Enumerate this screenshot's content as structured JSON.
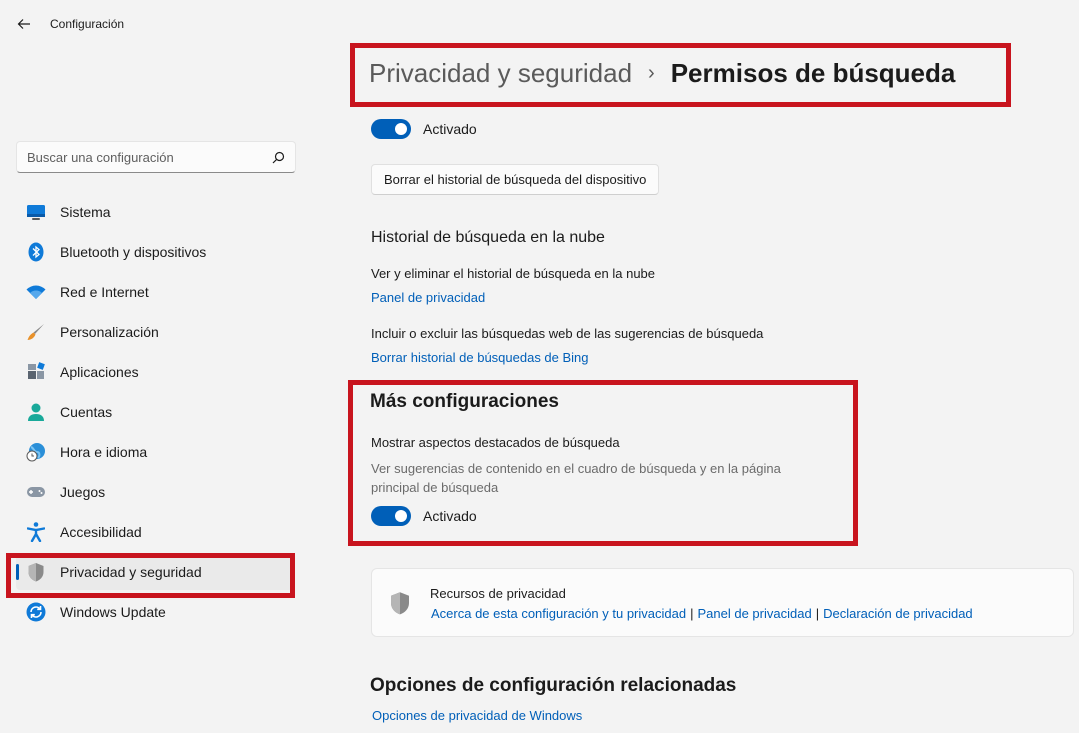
{
  "window": {
    "title": "Configuración"
  },
  "search": {
    "placeholder": "Buscar una configuración"
  },
  "sidebar": {
    "items": [
      {
        "label": "Sistema",
        "icon": "monitor-icon"
      },
      {
        "label": "Bluetooth y dispositivos",
        "icon": "bluetooth-icon"
      },
      {
        "label": "Red e Internet",
        "icon": "wifi-icon"
      },
      {
        "label": "Personalización",
        "icon": "paintbrush-icon"
      },
      {
        "label": "Aplicaciones",
        "icon": "apps-icon"
      },
      {
        "label": "Cuentas",
        "icon": "person-icon"
      },
      {
        "label": "Hora e idioma",
        "icon": "globe-clock-icon"
      },
      {
        "label": "Juegos",
        "icon": "gamepad-icon"
      },
      {
        "label": "Accesibilidad",
        "icon": "accessibility-icon"
      },
      {
        "label": "Privacidad y seguridad",
        "icon": "shield-icon",
        "active": true
      },
      {
        "label": "Windows Update",
        "icon": "update-icon"
      }
    ]
  },
  "header": {
    "parent": "Privacidad y seguridad",
    "separator": "›",
    "current": "Permisos de búsqueda"
  },
  "main": {
    "toggle_top": {
      "label": "Activado",
      "on": true
    },
    "clear_device_history_button": "Borrar el historial de búsqueda del dispositivo",
    "cloud_history": {
      "title": "Historial de búsqueda en la nube",
      "view_text": "Ver y eliminar el historial de búsqueda en la nube",
      "view_link": "Panel de privacidad",
      "include_text": "Incluir o excluir las búsquedas web de las sugerencias de búsqueda",
      "include_link": "Borrar historial de búsquedas de Bing"
    },
    "more_settings": {
      "title": "Más configuraciones",
      "highlights_title": "Mostrar aspectos destacados de búsqueda",
      "highlights_desc_line1": "Ver sugerencias de contenido en el cuadro de búsqueda y en la página",
      "highlights_desc_line2": "principal de búsqueda",
      "toggle": {
        "label": "Activado",
        "on": true
      }
    },
    "privacy_resources": {
      "title": "Recursos de privacidad",
      "links": [
        "Acerca de esta configuración y tu privacidad",
        "Panel de privacidad",
        "Declaración de privacidad"
      ],
      "separator": "|"
    },
    "related": {
      "title": "Opciones de configuración relacionadas",
      "link": "Opciones de privacidad de Windows"
    }
  },
  "colors": {
    "accent": "#005fb8",
    "highlight": "#c8141e",
    "background": "#f3f3f3"
  }
}
